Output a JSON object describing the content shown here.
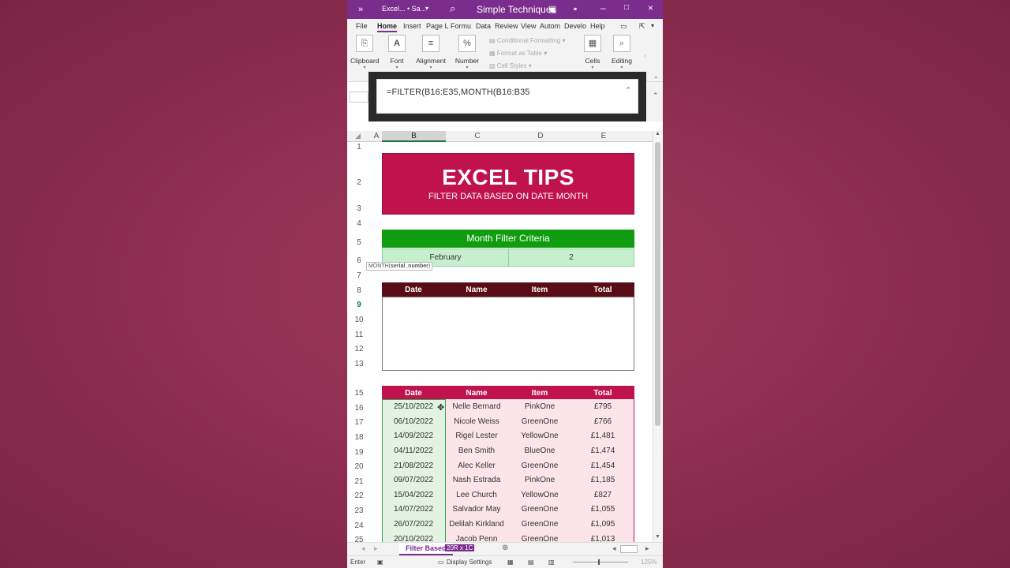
{
  "titlebar": {
    "file_label": "Excel... • Sa...",
    "title": "Simple Techniques"
  },
  "ribbon": {
    "tabs": [
      "File",
      "Home",
      "Insert",
      "Page L",
      "Formu",
      "Data",
      "Review",
      "View",
      "Autom",
      "Develo",
      "Help"
    ],
    "groups": [
      "Clipboard",
      "Font",
      "Alignment",
      "Number",
      "Cells",
      "Editing"
    ],
    "styles": [
      "Conditional Formatting",
      "Format as Table",
      "Cell Styles"
    ]
  },
  "formula": {
    "text": "=FILTER(B16:E35,MONTH(B16:B35"
  },
  "grid": {
    "columns": [
      "A",
      "B",
      "C",
      "D",
      "E"
    ],
    "rows": [
      "1",
      "2",
      "3",
      "4",
      "5",
      "6",
      "7",
      "8",
      "9",
      "10",
      "11",
      "12",
      "13",
      "15",
      "16",
      "17",
      "18",
      "19",
      "20",
      "21",
      "22",
      "23",
      "24",
      "25"
    ]
  },
  "banner": {
    "title": "EXCEL TIPS",
    "subtitle": "FILTER DATA BASED ON DATE MONTH"
  },
  "criteria": {
    "header": "Month Filter Criteria",
    "month": "February",
    "month_number": "2"
  },
  "tooltip": {
    "fn": "MONTH(",
    "arg": "serial_number",
    "close": ")"
  },
  "result_table": {
    "headers": [
      "Date",
      "Name",
      "Item",
      "Total"
    ]
  },
  "source_table": {
    "headers": [
      "Date",
      "Name",
      "Item",
      "Total"
    ],
    "rows": [
      [
        "25/10/2022",
        "Nelle Bernard",
        "PinkOne",
        "£795"
      ],
      [
        "06/10/2022",
        "Nicole Weiss",
        "GreenOne",
        "£766"
      ],
      [
        "14/09/2022",
        "Rigel Lester",
        "YellowOne",
        "£1,481"
      ],
      [
        "04/11/2022",
        "Ben Smith",
        "BlueOne",
        "£1,474"
      ],
      [
        "21/08/2022",
        "Alec Keller",
        "GreenOne",
        "£1,454"
      ],
      [
        "09/07/2022",
        "Nash Estrada",
        "PinkOne",
        "£1,185"
      ],
      [
        "15/04/2022",
        "Lee Church",
        "YellowOne",
        "£827"
      ],
      [
        "14/07/2022",
        "Salvador May",
        "GreenOne",
        "£1,055"
      ],
      [
        "26/07/2022",
        "Delilah Kirkland",
        "GreenOne",
        "£1,095"
      ],
      [
        "20/10/2022",
        "Jacob Penn",
        "GreenOne",
        "£1,013"
      ]
    ]
  },
  "sheet": {
    "tab_label": "Filter Based",
    "dim_label": "20R x 1C"
  },
  "status": {
    "mode": "Enter",
    "display_settings": "Display Settings",
    "zoom": "125%"
  },
  "colors": {
    "accent": "#7b2d8e",
    "banner": "#c0134d",
    "criteria_header": "#0f9d0f",
    "criteria_cell": "#c6efce",
    "result_header": "#5a0c16"
  }
}
